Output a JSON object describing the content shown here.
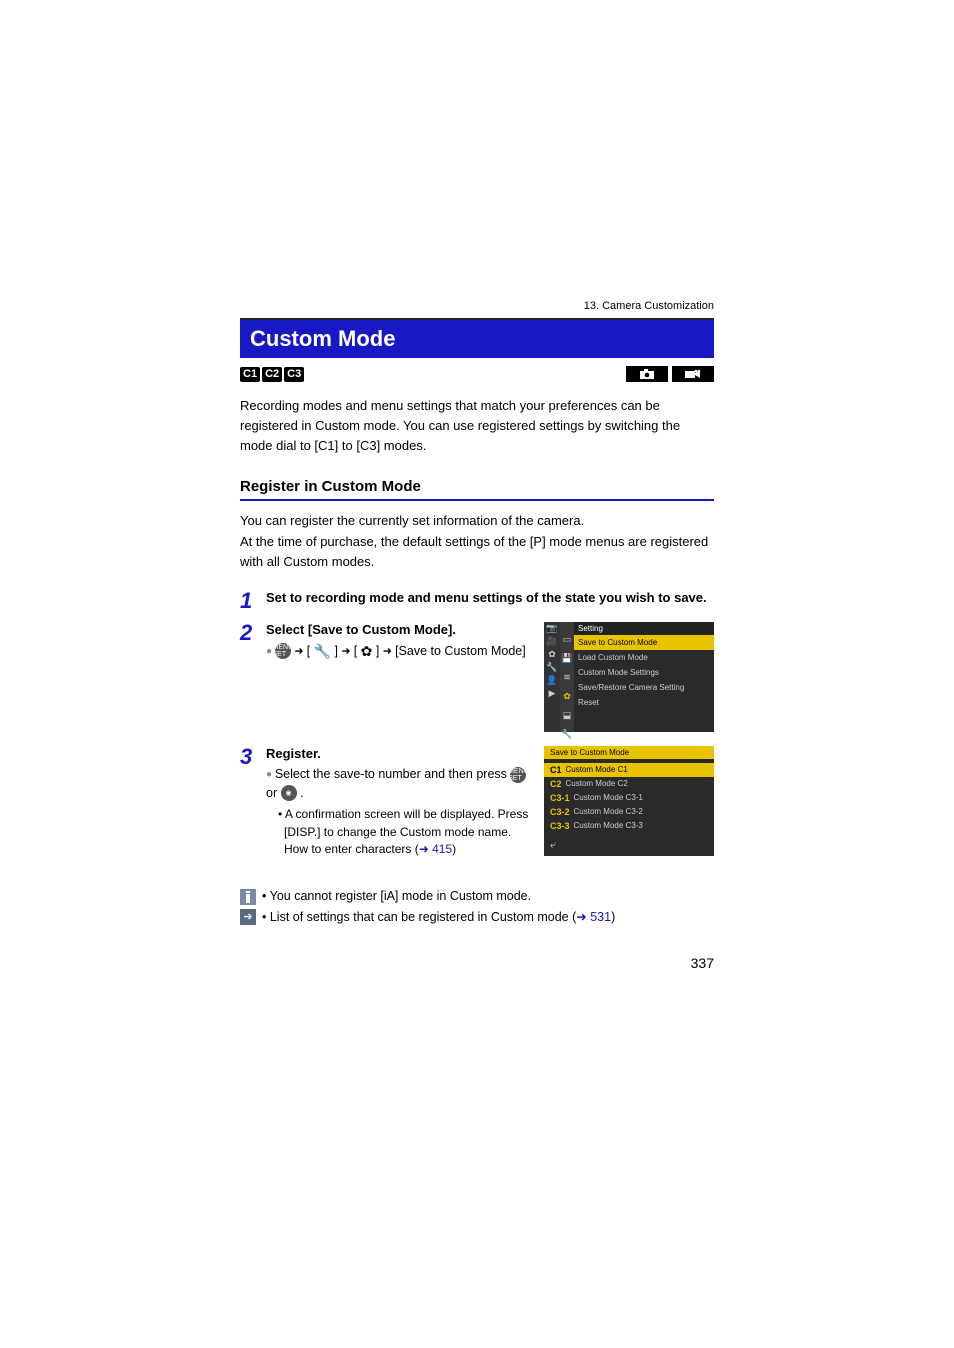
{
  "breadcrumb": "13. Camera Customization",
  "title": "Custom Mode",
  "mode_badges": [
    "C1",
    "C2",
    "C3"
  ],
  "intro": "Recording modes and menu settings that match your preferences can be registered in Custom mode. You can use registered settings by switching the mode dial to [C1] to [C3] modes.",
  "section": {
    "heading": "Register in Custom Mode",
    "text": "You can register the currently set information of the camera.\nAt the time of purchase, the default settings of the [P] mode menus are registered with all Custom modes."
  },
  "steps": {
    "s1": {
      "num": "1",
      "heading": "Set to recording mode and menu settings of the state you wish to save."
    },
    "s2": {
      "num": "2",
      "heading": "Select [Save to Custom Mode].",
      "trail_end": "[Save to Custom Mode]"
    },
    "s3": {
      "num": "3",
      "heading": "Register.",
      "line1": "Select the save-to number and then press ",
      "line1_end": " .",
      "or": " or ",
      "sub1": "A confirmation screen will be displayed. Press [DISP.] to change the Custom mode name.",
      "sub2_a": "How to enter characters (",
      "sub2_link": "415",
      "sub2_b": ")"
    }
  },
  "menu1": {
    "header": "Setting",
    "items": [
      "Save to Custom Mode",
      "Load Custom Mode",
      "Custom Mode Settings",
      "Save/Restore Camera Setting",
      "Reset"
    ]
  },
  "menu2": {
    "header": "Save to Custom Mode",
    "items": [
      {
        "badge": "C1",
        "label": "Custom Mode C1",
        "hl": true
      },
      {
        "badge": "C2",
        "label": "Custom Mode C2",
        "hl": false
      },
      {
        "badge": "C3-1",
        "label": "Custom Mode C3-1",
        "hl": false
      },
      {
        "badge": "C3-2",
        "label": "Custom Mode C3-2",
        "hl": false
      },
      {
        "badge": "C3-3",
        "label": "Custom Mode C3-3",
        "hl": false
      }
    ]
  },
  "notes": {
    "n1": "You cannot register [iA] mode in Custom mode.",
    "n2_a": "List of settings that can be registered in Custom mode (",
    "n2_link": "531",
    "n2_b": ")"
  },
  "page_number": "337"
}
